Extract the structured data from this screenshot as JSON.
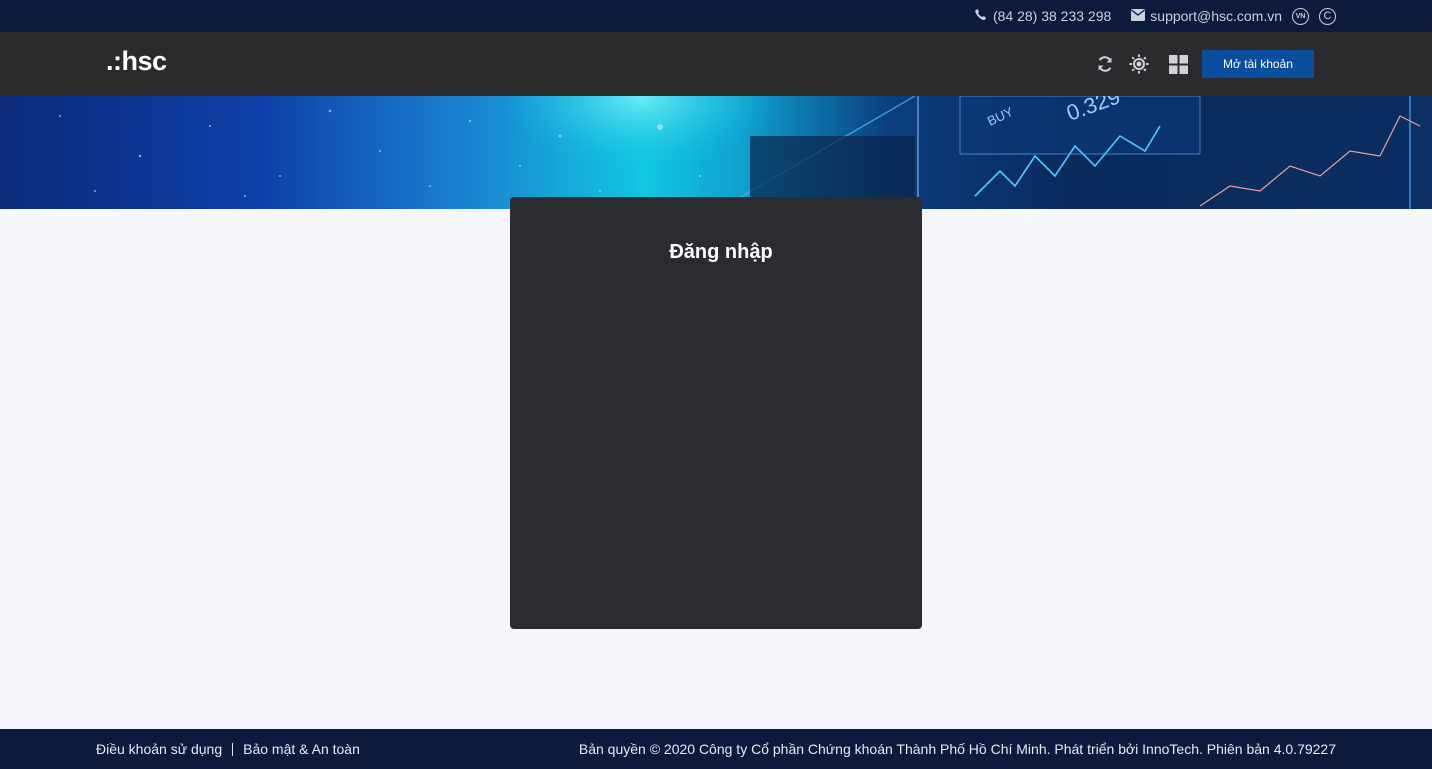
{
  "topbar": {
    "phone": "(84 28) 38 233 298",
    "email": "support@hsc.com.vn",
    "language_badge": "VN",
    "theme_badge": "C"
  },
  "header": {
    "logo_text": ".:hsc",
    "open_account_label": "Mở tài khoản",
    "icons": [
      "refresh-icon",
      "sun-icon",
      "grid-icon"
    ]
  },
  "banner": {
    "buy_text": "BUY",
    "price_text": "0.329"
  },
  "login": {
    "title": "Đăng nhập"
  },
  "footer": {
    "terms_label": "Điều khoản sử dụng",
    "security_label": "Bảo mật & An toàn",
    "copyright": "Bản quyền © 2020 Công ty Cổ phần Chứng khoán Thành Phố Hồ Chí Minh. Phát triển bởi InnoTech. Phiên bản 4.0.79227"
  },
  "colors": {
    "topbar_bg": "#0b1a3d",
    "header_bg": "#2b2b2d",
    "accent": "#0a4f9e",
    "card_bg": "#2b2c30",
    "page_bg": "#f5f7fa"
  }
}
